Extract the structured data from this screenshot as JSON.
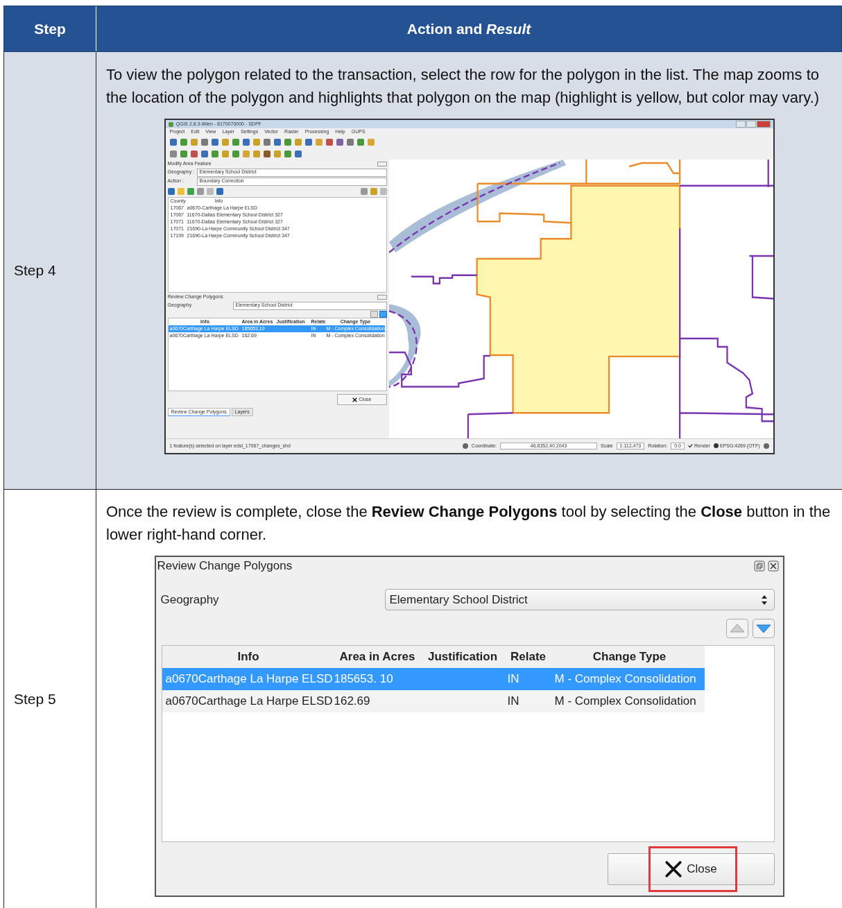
{
  "header": {
    "step": "Step",
    "action": "Action and *Result*"
  },
  "rows": [
    {
      "step": "Step 4",
      "text": "To view the polygon related to the transaction, select the row for the polygon in the list. The map zooms to the location of the polygon and highlights that polygon on the map (highlight is yellow, but color may vary.)",
      "screenshot": {
        "kind": "qgis",
        "window_title": "QGIS 2.8.3-Wien - 8170070000 - SDPF",
        "menu": [
          "Project",
          "Edit",
          "View",
          "Layer",
          "Settings",
          "Vector",
          "Raster",
          "Processing",
          "Help",
          "GUPS"
        ],
        "modify_panel": {
          "title": "Modify Area Feature",
          "fields": [
            {
              "label": "Geography :",
              "value": "Elementary School District"
            },
            {
              "label": "Action :",
              "value": "Boundary Correction"
            }
          ],
          "columns": [
            "County",
            "Info"
          ],
          "rows": [
            [
              "17067",
              "a0670-Carthage La Harpe ELSD"
            ],
            [
              "17067",
              "11670-Dallas Elementary School District 327"
            ],
            [
              "17071",
              "11670-Dallas Elementary School District 327"
            ],
            [
              "17071",
              "21690-La Harpe Community School District 347"
            ],
            [
              "17109",
              "21690-La Harpe Community School District 347"
            ]
          ]
        },
        "review_panel": {
          "title": "Review Change Polygons",
          "geography_label": "Geography",
          "geography_value": "Elementary School District",
          "columns": [
            "Info",
            "Area in Acres",
            "Justification",
            "Relate",
            "Change Type"
          ],
          "rows": [
            {
              "cells": [
                "a0670Carthage La Harpe ELSD",
                "185653.10",
                "",
                "IN",
                "M - Complex Consolidation"
              ],
              "selected": true
            },
            {
              "cells": [
                "a0670Carthage La Harpe ELSD",
                "162.69",
                "",
                "IN",
                "M - Complex Consolidation"
              ],
              "selected": false
            }
          ],
          "close": "Close"
        },
        "tabs": [
          {
            "label": "Review Change Polygons",
            "selected": true
          },
          {
            "label": "Layers",
            "selected": false
          }
        ],
        "status_message": "1 feature(s) selected on layer edsl_17067_changes_shd",
        "status_bar": {
          "coordinate_label": "Coordinate:",
          "coordinate": "46.8352,40.2043",
          "scale_label": "Scale",
          "scale": "1:112,473",
          "rotation_label": "Rotation:",
          "rotation": "0.0",
          "render_label": "Render",
          "render": true,
          "crs": "EPSG:4269 (OTF)"
        }
      }
    },
    {
      "step": "Step 5",
      "text": "Once the review is complete, close the **Review Change Polygons** tool by selecting the **Close** button in the lower right-hand corner.",
      "screenshot": {
        "kind": "dialog",
        "title": "Review Change Polygons",
        "geography_label": "Geography",
        "geography_value": "Elementary School District",
        "columns": [
          "Info",
          "Area in Acres",
          "Justification",
          "Relate",
          "Change Type"
        ],
        "rows": [
          {
            "cells": [
              "a0670Carthage La Harpe ELSD",
              "185653. 10",
              "",
              "IN",
              "M - Complex Consolidation"
            ],
            "selected": true
          },
          {
            "cells": [
              "a0670Carthage La Harpe ELSD",
              "162.69",
              "",
              "IN",
              "M - Complex Consolidation"
            ],
            "selected": false
          }
        ],
        "close": "Close",
        "close_highlighted": true
      }
    }
  ]
}
